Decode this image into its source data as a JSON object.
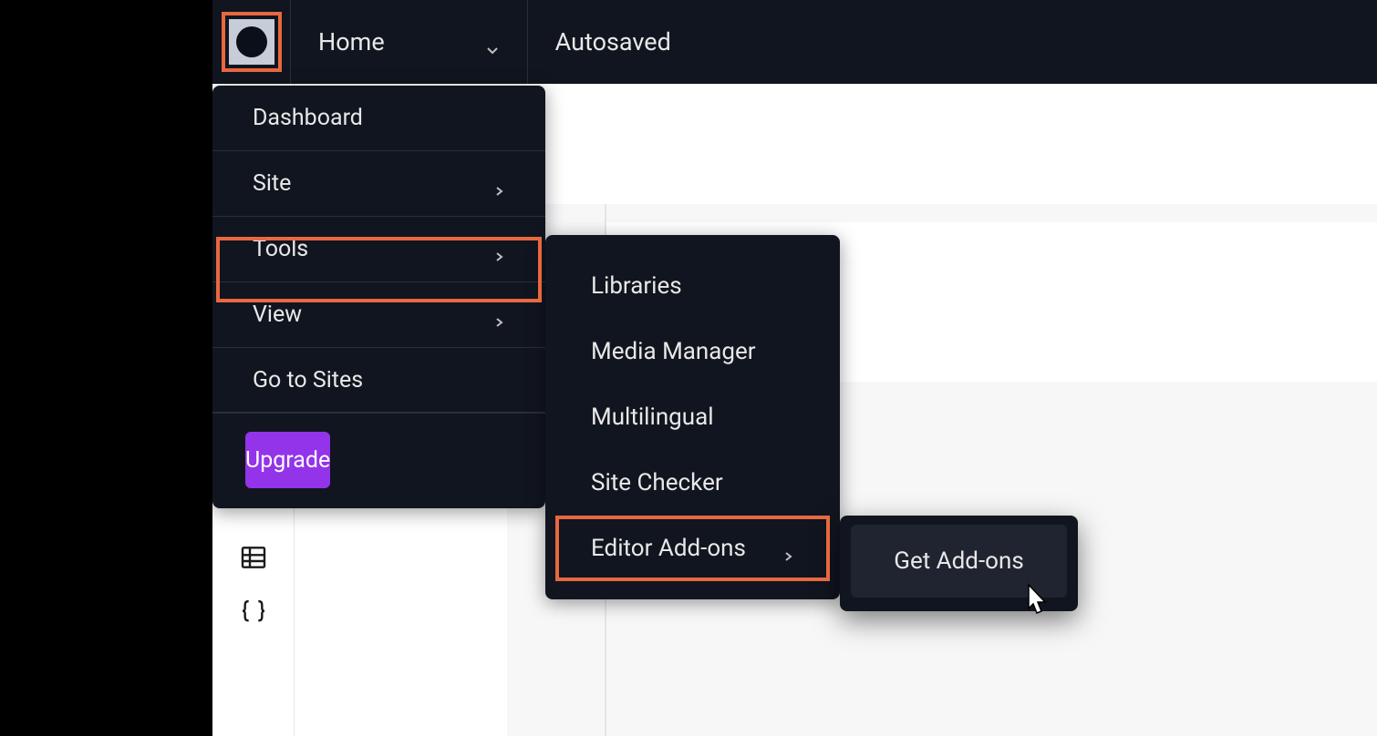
{
  "header": {
    "page_label": "Home",
    "status": "Autosaved"
  },
  "main_menu": {
    "items": [
      {
        "label": "Dashboard",
        "has_submenu": false
      },
      {
        "label": "Site",
        "has_submenu": true
      },
      {
        "label": "Tools",
        "has_submenu": true,
        "highlighted": true
      },
      {
        "label": "View",
        "has_submenu": true
      },
      {
        "label": "Go to Sites",
        "has_submenu": false
      }
    ],
    "upgrade_label": "Upgrade"
  },
  "tools_submenu": {
    "items": [
      {
        "label": "Libraries",
        "has_submenu": false
      },
      {
        "label": "Media Manager",
        "has_submenu": false
      },
      {
        "label": "Multilingual",
        "has_submenu": false
      },
      {
        "label": "Site Checker",
        "has_submenu": false
      },
      {
        "label": "Editor Add-ons",
        "has_submenu": true,
        "highlighted": true
      }
    ]
  },
  "addons_submenu": {
    "items": [
      {
        "label": "Get Add-ons"
      }
    ]
  },
  "colors": {
    "highlight": "#e8683f",
    "upgrade": "#9333ea",
    "dark_bg": "#11151f"
  }
}
